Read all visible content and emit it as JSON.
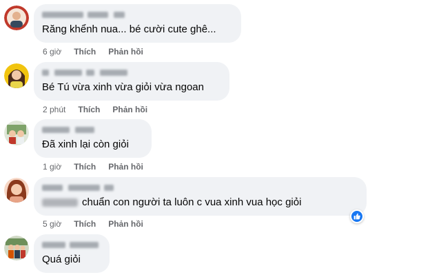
{
  "comments": [
    {
      "author_name": "",
      "text": "Răng khểnh nua... bé cười cute ghê...",
      "time": "6 giờ",
      "like_label": "Thích",
      "reply_label": "Phản hồi"
    },
    {
      "author_name": "",
      "text": "Bé Tú vừa xinh vừa giỏi vừa ngoan",
      "time": "2 phút",
      "like_label": "Thích",
      "reply_label": "Phản hồi"
    },
    {
      "author_name": "",
      "text": "Đã xinh lại còn giỏi",
      "time": "1 giờ",
      "like_label": "Thích",
      "reply_label": "Phản hồi"
    },
    {
      "author_name": "",
      "text": "chuẩn con người ta luôn c vua xinh vua học giỏi",
      "time": "5 giờ",
      "like_label": "Thích",
      "reply_label": "Phản hồi",
      "reaction_icon": "like-icon"
    },
    {
      "author_name": "",
      "text": "Quá giỏi",
      "time": "",
      "like_label": "",
      "reply_label": ""
    }
  ],
  "colors": {
    "bubble": "#f0f2f5",
    "text": "#050505",
    "meta": "#65676b",
    "like_blue": "#1877f2"
  }
}
